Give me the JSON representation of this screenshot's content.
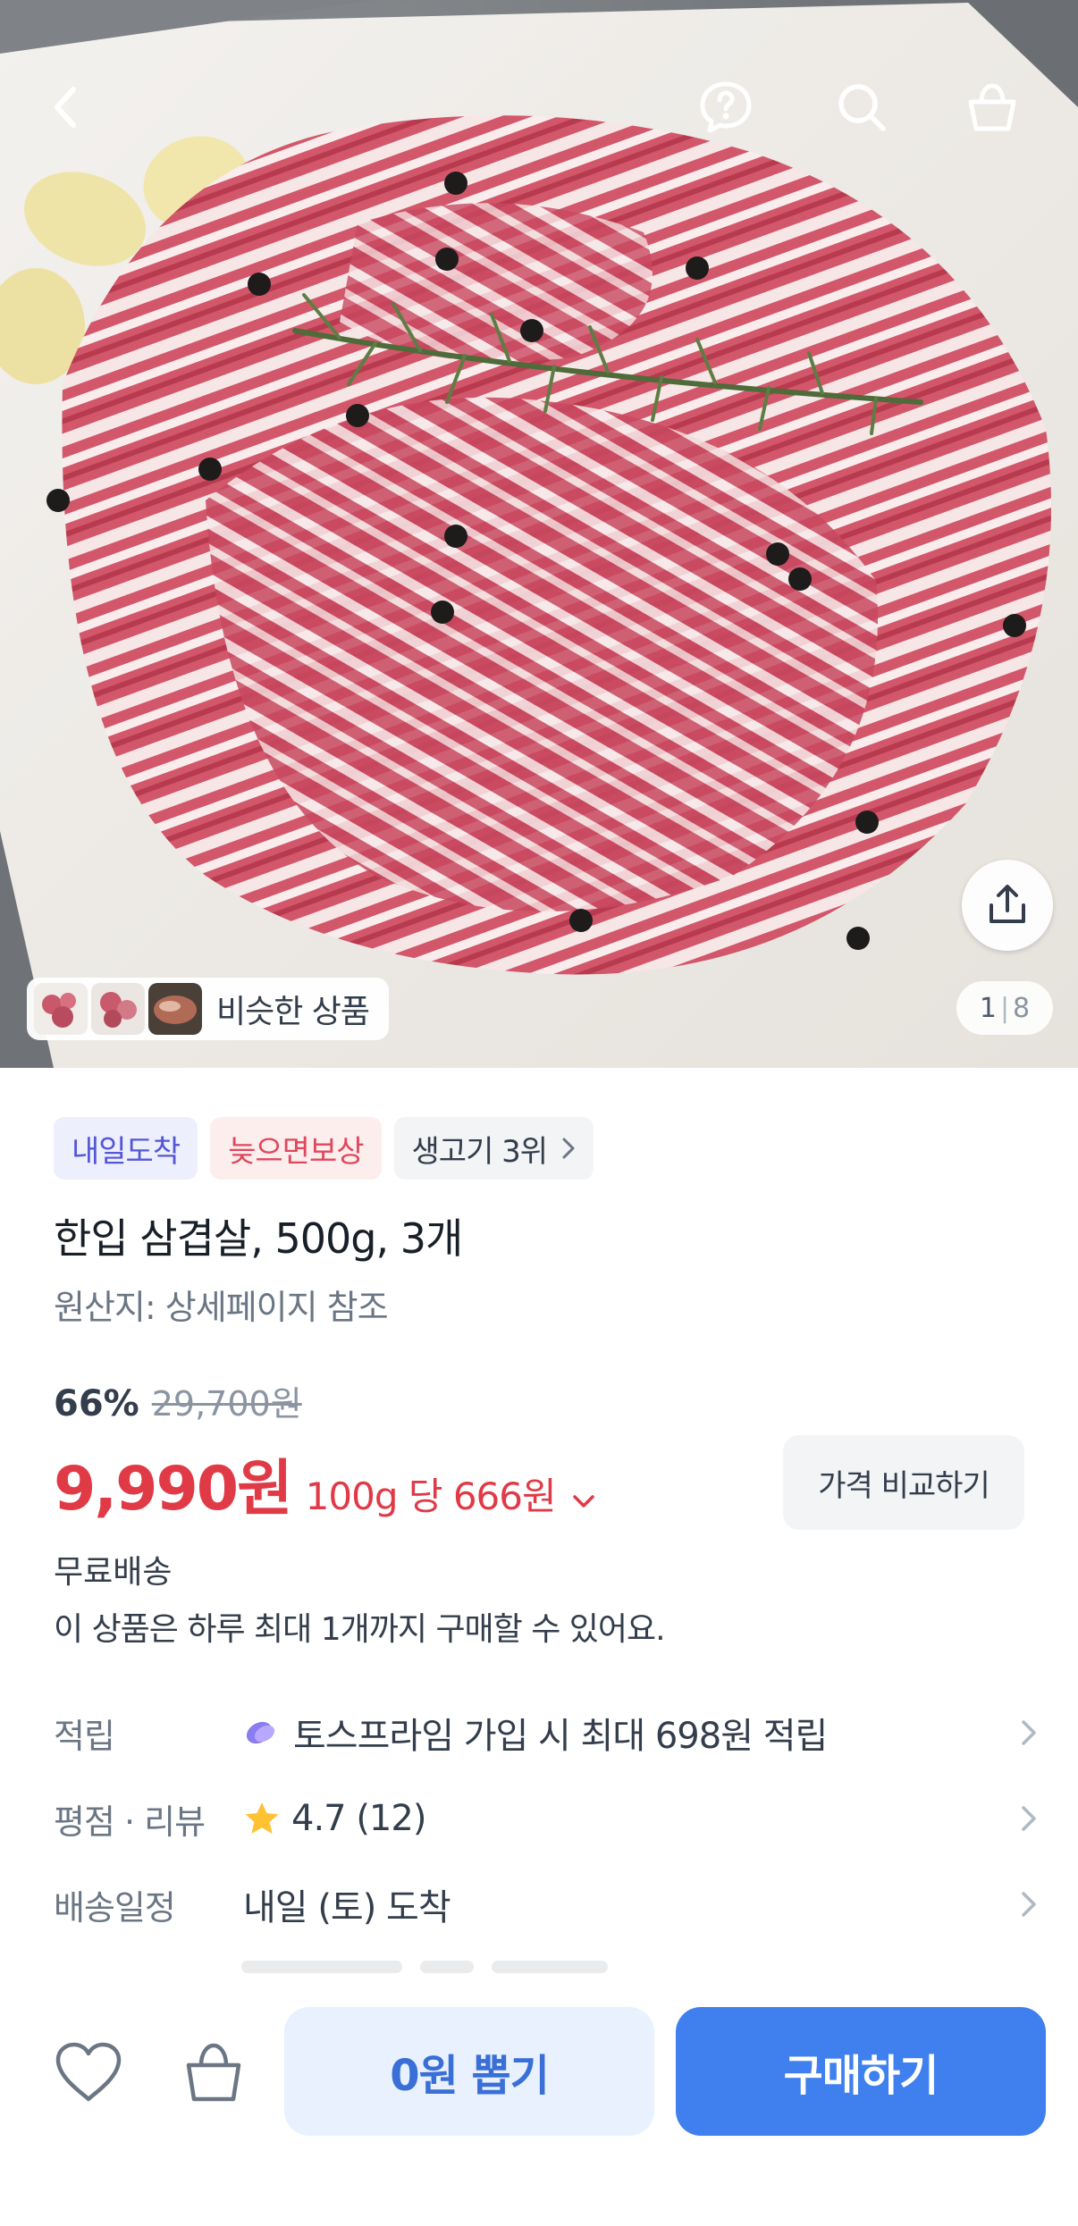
{
  "gallery": {
    "current_page": "1",
    "separator": "|",
    "total_pages": "8",
    "similar_label": "비슷한 상품"
  },
  "tags": [
    {
      "label": "내일도착"
    },
    {
      "label": "늦으면보상"
    },
    {
      "label": "생고기 3위"
    }
  ],
  "product": {
    "title": "한입 삼겹살, 500g, 3개",
    "origin": "원산지: 상세페이지 참조",
    "discount": "66%",
    "original_price": "29,700원",
    "price": "9,990원",
    "unit_price": "100g 당 666원",
    "compare_label": "가격 비교하기",
    "shipping": "무료배송",
    "purchase_limit": "이 상품은 하루 최대 1개까지 구매할 수 있어요."
  },
  "info_rows": {
    "points": {
      "label": "적립",
      "value": "토스프라임 가입 시 최대 698원 적립"
    },
    "rating": {
      "label": "평점 · 리뷰",
      "value": "4.7 (12)"
    },
    "delivery": {
      "label": "배송일정",
      "value": "내일 (토) 도착"
    }
  },
  "bottom_bar": {
    "zero_won_label": "0원 뽑기",
    "buy_label": "구매하기"
  },
  "colors": {
    "price_red": "#e03a47",
    "buy_blue": "#3f80ee",
    "tag_blue": "#5457d6",
    "tag_red": "#e0475a"
  }
}
